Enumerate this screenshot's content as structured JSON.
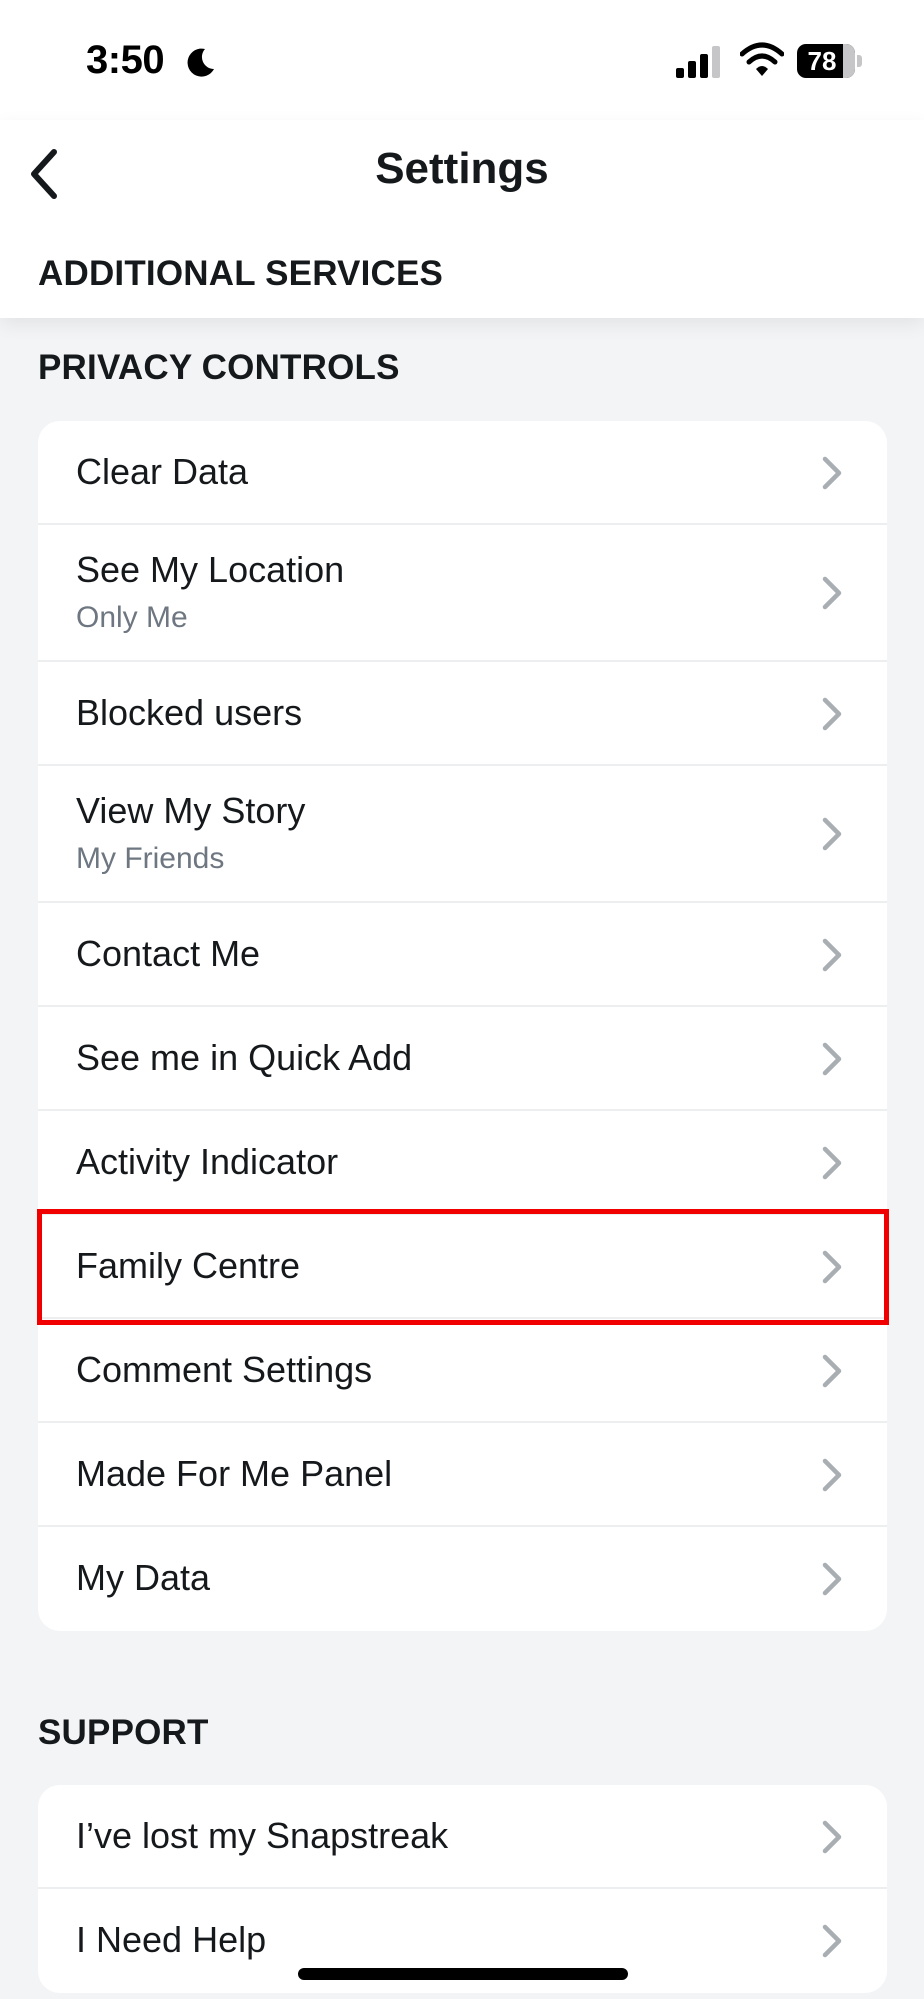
{
  "status_bar": {
    "time": "3:50",
    "battery": "78",
    "icons": [
      "moon-icon",
      "signal-icon",
      "wifi-icon",
      "battery-icon"
    ]
  },
  "header": {
    "title": "Settings",
    "back_icon": "chevron-left-icon"
  },
  "sections": {
    "additional_services": "ADDITIONAL SERVICES",
    "privacy_controls": "PRIVACY CONTROLS",
    "support": "SUPPORT"
  },
  "privacy_items": [
    {
      "label": "Clear Data"
    },
    {
      "label": "See My Location",
      "sub": "Only Me"
    },
    {
      "label": "Blocked users"
    },
    {
      "label": "View My Story",
      "sub": "My Friends"
    },
    {
      "label": "Contact Me"
    },
    {
      "label": "See me in Quick Add"
    },
    {
      "label": "Activity Indicator"
    },
    {
      "label": "Family Centre"
    },
    {
      "label": "Comment Settings"
    },
    {
      "label": "Made For Me Panel"
    },
    {
      "label": "My Data"
    }
  ],
  "support_items": [
    {
      "label": "I’ve lost my Snapstreak"
    },
    {
      "label": "I Need Help"
    }
  ],
  "colors": {
    "highlight": "#f00000",
    "background": "#f3f4f5",
    "subtitle": "#6e7781",
    "chevron": "#a9aeb3"
  }
}
